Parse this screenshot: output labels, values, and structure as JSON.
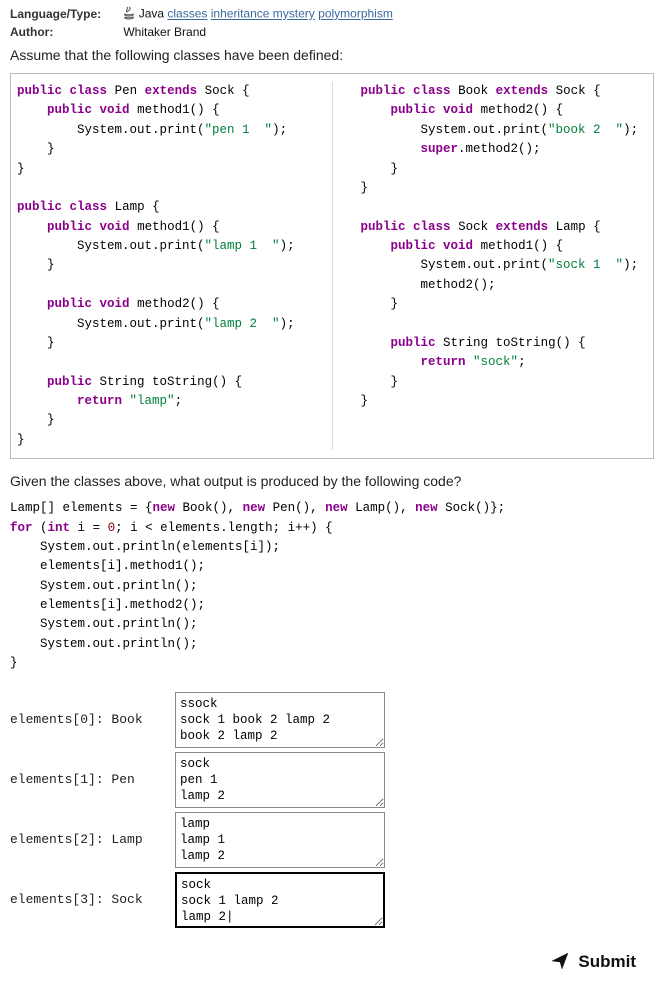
{
  "meta": {
    "language_type_label": "Language/Type:",
    "language_type_prefix": "Java",
    "tags": [
      "classes",
      "inheritance mystery",
      "polymorphism"
    ],
    "author_label": "Author:",
    "author_value": "Whitaker Brand"
  },
  "intro": "Assume that the following classes have been defined:",
  "code_left": {
    "pen_decl_1": "public",
    "pen_decl_2": "class",
    "pen_decl_name": "Pen",
    "pen_decl_3": "extends",
    "pen_decl_super": "Sock {",
    "pen_m1_1": "public",
    "pen_m1_2": "void",
    "pen_m1_name": "method1() {",
    "pen_m1_body": "System.out.print(",
    "pen_m1_str": "\"pen 1  \"",
    "pen_m1_end": ");",
    "lamp_decl_1": "public",
    "lamp_decl_2": "class",
    "lamp_decl_name": "Lamp {",
    "lamp_m1_1": "public",
    "lamp_m1_2": "void",
    "lamp_m1_name": "method1() {",
    "lamp_m1_body": "System.out.print(",
    "lamp_m1_str": "\"lamp 1  \"",
    "lamp_m1_end": ");",
    "lamp_m2_1": "public",
    "lamp_m2_2": "void",
    "lamp_m2_name": "method2() {",
    "lamp_m2_body": "System.out.print(",
    "lamp_m2_str": "\"lamp 2  \"",
    "lamp_m2_end": ");",
    "lamp_ts_1": "public",
    "lamp_ts_2": "String toStrin",
    "lamp_ts_3": "g() {",
    "lamp_ts_ret1": "return",
    "lamp_ts_str": "\"lamp\"",
    "lamp_ts_end": ";"
  },
  "code_right": {
    "book_decl_1": "public",
    "book_decl_2": "class",
    "book_decl_name": "Book",
    "book_decl_3": "extends",
    "book_decl_super": "Sock {",
    "book_m2_1": "public",
    "book_m2_2": "void",
    "book_m2_name": "method2() {",
    "book_m2_body": "System.out.print(",
    "book_m2_str": "\"book 2  \"",
    "book_m2_end": ");",
    "book_m2_super1": "super",
    "book_m2_super2": ".method2();",
    "sock_decl_1": "public",
    "sock_decl_2": "class",
    "sock_decl_name": "Sock",
    "sock_decl_3": "extends",
    "sock_decl_super": "Lamp {",
    "sock_m1_1": "public",
    "sock_m1_2": "void",
    "sock_m1_name": "method1() {",
    "sock_m1_body": "System.out.print(",
    "sock_m1_str": "\"sock 1  \"",
    "sock_m1_end": ");",
    "sock_m1_call": "method2();",
    "sock_ts_1": "public",
    "sock_ts_2": "String toStrin",
    "sock_ts_3": "g() {",
    "sock_ts_ret1": "return",
    "sock_ts_str": "\"sock\"",
    "sock_ts_end": ";"
  },
  "question": "Given the classes above, what output is produced by the following code?",
  "driver_code": {
    "l1a": "Lamp[] elements = {",
    "l1b": "new",
    "l1c": " Book(), ",
    "l1d": "new",
    "l1e": " Pen(), ",
    "l1f": "new",
    "l1g": " Lamp(), ",
    "l1h": "new",
    "l1i": " Sock()};",
    "l2a": "for",
    "l2b": " (",
    "l2c": "int",
    "l2d": " i = ",
    "l2e": "0",
    "l2f": "; i < elements.length; i++) {",
    "l3": "    System.out.println(elements[i]);",
    "l4": "    elements[i].method1();",
    "l5": "    System.out.println();",
    "l6": "    elements[i].method2();",
    "l7": "    System.out.println();",
    "l8": "    System.out.println();",
    "l9": "}"
  },
  "answers": [
    {
      "label": "elements[0]: Book",
      "value": "ssock\nsock 1 book 2 lamp 2\nbook 2 lamp 2",
      "focused": false
    },
    {
      "label": "elements[1]: Pen",
      "value": "sock\npen 1\nlamp 2",
      "focused": false
    },
    {
      "label": "elements[2]: Lamp",
      "value": "lamp\nlamp 1\nlamp 2",
      "focused": false
    },
    {
      "label": "elements[3]: Sock",
      "value": "sock\nsock 1 lamp 2\nlamp 2|",
      "focused": true
    }
  ],
  "submit_label": "Submit"
}
